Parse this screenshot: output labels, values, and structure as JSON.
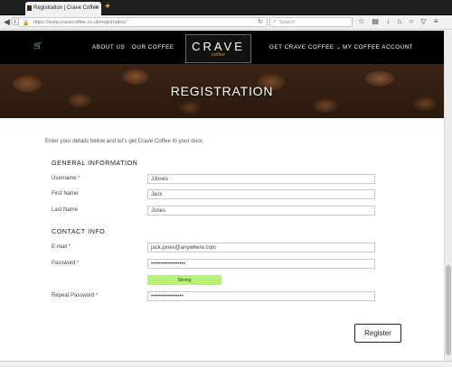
{
  "browser": {
    "tab_title": "Registration | Crave Coffee",
    "tab_close": "×",
    "new_tab": "+",
    "url": "https://www.cravecoffee.co.uk/registration/",
    "search_placeholder": "Search",
    "back_icon": "back-arrow-icon",
    "toolbar_icons": "☆ ▤ ↓ ⌂ ○ ▽ ≡"
  },
  "site": {
    "cart_icon": "cart-icon",
    "nav": {
      "about": "ABOUT US",
      "our_coffee": "OUR COFFEE",
      "get_coffee": "GET CRAVE COFFEE ⌄",
      "account": "MY COFFEE ACCOUNT"
    },
    "logo": {
      "brand": "CRAVE",
      "sub": "coffee"
    },
    "hero_title": "REGISTRATION"
  },
  "form": {
    "intro": "Enter your details below and let's get Crave Coffee to your door.",
    "general_title": "GENERAL INFORMATION",
    "contact_title": "CONTACT INFO",
    "username_label": "Username",
    "username_value": "JJones",
    "firstname_label": "First Name",
    "firstname_value": "Jack",
    "lastname_label": "Last Name",
    "lastname_value": "Jones",
    "email_label": "E-mail",
    "email_value": "jack.jones@anywhere.com",
    "password_label": "Password",
    "password_value": "••••••••••••••••••",
    "strength_label": "Strong",
    "repeat_label": "Repeat Password",
    "repeat_value": "•••••••••••••••••",
    "required_mark": "*",
    "submit_label": "Register"
  },
  "colors": {
    "header_bg": "#000000",
    "strength_bg": "#b8f07c",
    "required": "#c0392b"
  }
}
